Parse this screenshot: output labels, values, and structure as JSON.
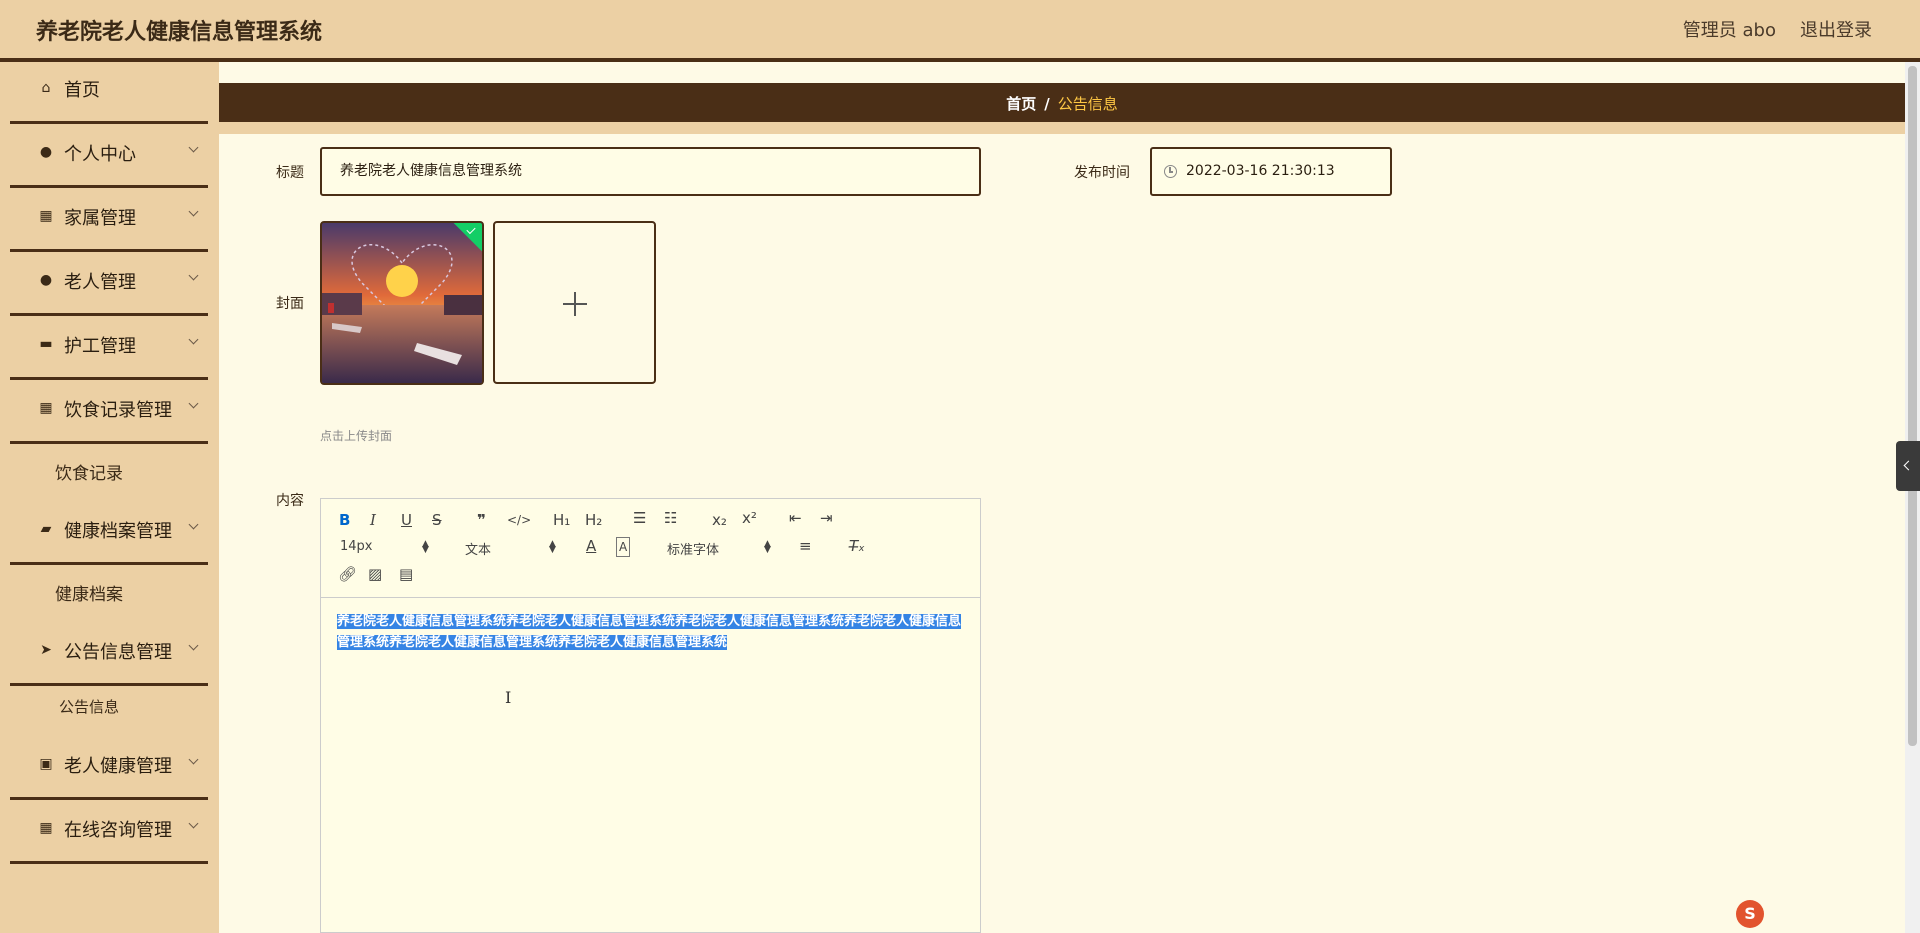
{
  "header": {
    "title": "养老院老人健康信息管理系统",
    "user": "管理员 abo",
    "logout": "退出登录"
  },
  "sidebar": {
    "items": [
      {
        "label": "首页",
        "icon": "home-icon"
      },
      {
        "label": "个人中心",
        "icon": "user-icon"
      },
      {
        "label": "家属管理",
        "icon": "grid-icon"
      },
      {
        "label": "老人管理",
        "icon": "user-icon"
      },
      {
        "label": "护工管理",
        "icon": "chat-icon"
      },
      {
        "label": "饮食记录管理",
        "icon": "grid-icon"
      },
      {
        "label": "健康档案管理",
        "icon": "wallet-icon"
      },
      {
        "label": "公告信息管理",
        "icon": "send-icon"
      },
      {
        "label": "老人健康管理",
        "icon": "briefcase-icon"
      },
      {
        "label": "在线咨询管理",
        "icon": "grid-icon"
      }
    ],
    "subitems": [
      {
        "label": "饮食记录"
      },
      {
        "label": "健康档案"
      },
      {
        "label": "公告信息"
      }
    ]
  },
  "breadcrumb": {
    "home": "首页",
    "separator": "/",
    "current": "公告信息"
  },
  "form": {
    "title_label": "标题",
    "title_value": "养老院老人健康信息管理系统",
    "time_label": "发布时间",
    "time_value": "2022-03-16 21:30:13",
    "cover_label": "封面",
    "cover_tip": "点击上传封面",
    "content_label": "内容"
  },
  "editor": {
    "font_size": "14px",
    "text_style": "文本",
    "font_family": "标准字体",
    "content": "养老院老人健康信息管理系统养老院老人健康信息管理系统养老院老人健康信息管理系统养老院老人健康信息管理系统养老院老人健康信息管理系统养老院老人健康信息管理系统"
  },
  "colors": {
    "accent": "#4a2e16",
    "sidebar_bg": "#ecd0a4",
    "page_bg": "#fefae6",
    "breadcrumb_current": "#ffc845",
    "selection": "#3584e4"
  }
}
